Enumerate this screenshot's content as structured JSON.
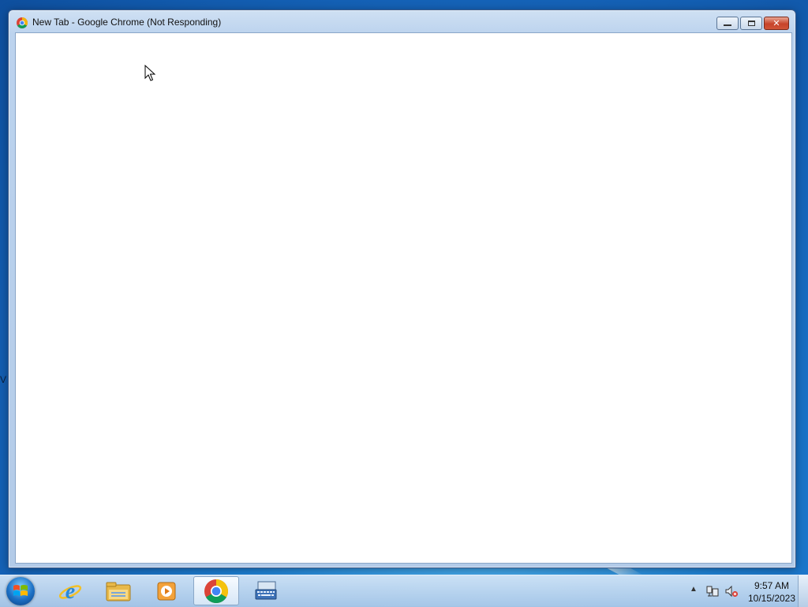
{
  "window": {
    "title": "New Tab - Google Chrome (Not Responding)",
    "app_icon": "chrome-icon",
    "controls": {
      "minimize": "minimize-icon",
      "maximize": "restore-icon",
      "close": "✕"
    }
  },
  "desktop": {
    "edge_fragment": "V"
  },
  "taskbar": {
    "start_icon": "windows-start-orb",
    "pinned": [
      {
        "name": "Internet Explorer",
        "icon": "internet-explorer-icon"
      },
      {
        "name": "Windows Explorer",
        "icon": "folder-icon"
      },
      {
        "name": "Windows Media Player",
        "icon": "media-player-icon"
      },
      {
        "name": "Google Chrome",
        "icon": "chrome-icon",
        "active": true
      },
      {
        "name": "On-Screen Keyboard",
        "icon": "keyboard-icon"
      }
    ],
    "tray": {
      "show_hidden": "▲",
      "network_icon": "network-icon",
      "volume_icon": "volume-muted-icon",
      "time": "9:57 AM",
      "date": "10/15/2023"
    }
  },
  "colors": {
    "accent": "#1e82d6",
    "close_button": "#c7432a"
  }
}
